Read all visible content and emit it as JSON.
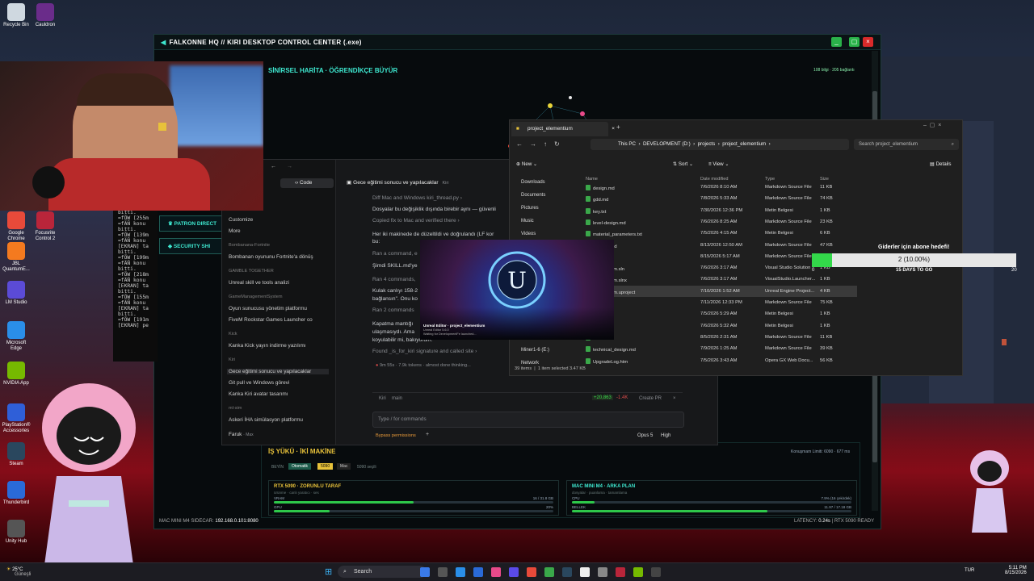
{
  "desktop": {
    "icons": [
      {
        "label": "Recycle Bin",
        "color": "#cfd8e0"
      },
      {
        "label": "Cauldron",
        "color": "#6a2c8a"
      },
      {
        "label": "Google Chrome",
        "color": "#e84a3a"
      },
      {
        "label": "Focusrite Control 2",
        "color": "#b9253a"
      },
      {
        "label": "JBL QuantumE...",
        "color": "#f47a1f"
      },
      {
        "label": "LM Studio",
        "color": "#5b4bd6"
      },
      {
        "label": "Microsoft Edge",
        "color": "#2a8ee8"
      },
      {
        "label": "NVIDIA App",
        "color": "#76b900"
      },
      {
        "label": "PlayStation® Accessories",
        "color": "#2f5fd8"
      },
      {
        "label": "Steam",
        "color": "#2a475e"
      },
      {
        "label": "Thunderbird",
        "color": "#2a6ad8"
      },
      {
        "label": "Unity Hub",
        "color": "#555"
      }
    ]
  },
  "app": {
    "title": "FALKONNE HQ // KIRI DESKTOP CONTROL CENTER (.exe)",
    "map_title": "SİNİRSEL HARİTA · ÖĞRENDİKÇE BÜYÜR",
    "map_stats": "108 bilgi · 205 bağlantı",
    "side_buttons": [
      "PATRON DIRECT",
      "SECURITY SHI"
    ],
    "status_left_label": "MAC MINI M4 SIDECAR:",
    "status_left_value": "192.168.0.101:8080",
    "status_right_label": "LATENCY:",
    "status_right_value": "0.24s",
    "status_right_extra": "| RTX 5090 READY",
    "workload": {
      "title": "İŞ YÜKÜ · İKİ MAKİNE",
      "usage": "Konuşmam Limiti: 6090 · 677 ms",
      "filter_label": "BEYİN",
      "filters": [
        "Otomatik",
        "5090",
        "Mac",
        "5090 seçili"
      ],
      "left": {
        "title": "RTX 5090 · ZORUNLU TARAF",
        "sub": "ürünme · canlı yaratıcı · ses",
        "vram_label": "VRAM",
        "vram_value": "16 / 31.8 GB",
        "vram_pct": 0.5,
        "gpu_label": "GPU",
        "gpu_value": "20%",
        "gpu_pct": 0.2
      },
      "right": {
        "title": "MAC MINI M4 · ARKA PLAN",
        "sub": "dosyalar · puanlama · tamamlama",
        "cpu_label": "CPU",
        "cpu_value": "7.9% (16 çekirdek)",
        "cpu_pct": 0.08,
        "mem_label": "BELLEK",
        "mem_value": "11.97 / 17.18 GB",
        "mem_pct": 0.7
      }
    }
  },
  "terminal": {
    "lines": [
      "bitti.",
      "=fÖW [255m",
      "=fÄÑ konu",
      "bitti.",
      "=fÖW [139m",
      "=fÄÑ konu",
      "[EKRAN] ta",
      "bitti.",
      "=fÖW [199m",
      "=fÄÑ konu",
      "bitti.",
      "=fÖW [218m",
      "=fÄÑ konu",
      "[EKRAN] ta",
      "bitti.",
      "=fÖW [155m",
      "=fÄÑ konu",
      "[EKRAN] ta",
      "bitti.",
      "=fÖW [191m",
      "[EKRAN] pe"
    ]
  },
  "code": {
    "tab": "Code",
    "thread_title": "Gece eğitimi sonucu ve yapılacaklar",
    "thread_badge": "Kiri",
    "side_items": [
      {
        "type": "item",
        "text": "Customize"
      },
      {
        "type": "item",
        "text": "More"
      },
      {
        "type": "group",
        "text": "Bombanana-Fortnite"
      },
      {
        "type": "item",
        "text": "Bombanan oyununu Fortnite'a dönüş"
      },
      {
        "type": "group",
        "text": "GAMBLE TOGETHER"
      },
      {
        "type": "item",
        "text": "Unreal skill ve tools analizi"
      },
      {
        "type": "group",
        "text": "GameManagementSystem"
      },
      {
        "type": "item",
        "text": "Oyun sunucusu yönetim platformu"
      },
      {
        "type": "item",
        "text": "FiveM Rockstar Games Launcher co"
      },
      {
        "type": "group",
        "text": "Kick"
      },
      {
        "type": "item",
        "text": "Kanka Kick yayın indirme yazılımı"
      },
      {
        "type": "group",
        "text": "Kiri"
      },
      {
        "type": "item",
        "text": "Gece eğitimi sonucu ve yapılacaklar"
      },
      {
        "type": "item",
        "text": "Git pull ve Windows görevi"
      },
      {
        "type": "item",
        "text": "Kanka Kiri avatar tasarımı"
      },
      {
        "type": "group",
        "text": "ml-sim"
      },
      {
        "type": "item",
        "text": "Askeri İHA simülasyon platformu"
      }
    ],
    "user": "Faruk",
    "user_plan": "Max",
    "lines": [
      {
        "text": "Diff Mac and Windows kiri_thread.py ›",
        "dim": true
      },
      {
        "text": "Dosyalar bu değişiklik dışında birebir aynı — güvenli",
        "dim": false
      },
      {
        "text": "Copied fix to Mac and verified there ›",
        "dim": true
      },
      {
        "text": "Her iki makinede de düzeltildi ve doğrulandı (LF kor",
        "dim": false
      },
      {
        "text": "bu:",
        "dim": false
      },
      {
        "text": "Ran a command, e",
        "dim": true
      },
      {
        "text": "Şimdi SKILL.md'ye",
        "dim": false
      },
      {
        "text": "Ran 4 commands,",
        "dim": true
      },
      {
        "text": "Kulak canlıyı 158-2",
        "dim": false
      },
      {
        "text": "bağlansın\". Onu ko",
        "dim": false
      },
      {
        "text": "Ran 2 commands",
        "dim": true
      },
      {
        "text": "Kapatma mantığı",
        "dim": false
      },
      {
        "text": "ulaşmasıydı. Ama",
        "dim": false
      },
      {
        "text": "koyulabilir mi, bakıyorum.",
        "dim": false
      },
      {
        "text": "Found _is_for_kiri signature and called site ›",
        "dim": true
      }
    ],
    "thinking": "9m 55s · 7.9k tokens · almost done thinking...",
    "branch_user": "Kiri",
    "branch": "main",
    "diff": "+20,863",
    "diff_minus": "-1.4K",
    "create_pr": "Create PR",
    "input_placeholder": "Type / for commands",
    "bypass": "Bypass permissions",
    "model": "Opus 5",
    "effort": "High"
  },
  "explorer": {
    "tab": "project_elementium",
    "breadcrumb": [
      "This PC",
      "DEVELOPMENT (D:)",
      "projects",
      "project_elementium"
    ],
    "search": "Search project_elementium",
    "toolbar": [
      "New",
      "Sort",
      "View",
      "Details"
    ],
    "columns": [
      "Name",
      "Date modified",
      "Type",
      "Size"
    ],
    "nav": [
      "Downloads",
      "Documents",
      "Pictures",
      "Music",
      "Videos",
      "Miner1-6 (E:)",
      "Network"
    ],
    "files": [
      [
        "design.md",
        "7/6/2026 8:10 AM",
        "Markdown Source File",
        "11 KB"
      ],
      [
        "gdd.md",
        "7/8/2026 5:33 AM",
        "Markdown Source File",
        "74 KB"
      ],
      [
        "key.txt",
        "7/30/2026 12:36 PM",
        "Metin Belgesi",
        "1 KB"
      ],
      [
        "level-design.md",
        "7/6/2026 8:25 AM",
        "Markdown Source File",
        "23 KB"
      ],
      [
        "material_parameters.txt",
        "7/5/2026 4:15 AM",
        "Metin Belgesi",
        "6 KB"
      ],
      [
        "pipeline.md",
        "8/13/2026 12:50 AM",
        "Markdown Source File",
        "47 KB"
      ],
      [
        ".md",
        "8/15/2026 5:17 AM",
        "Markdown Source File",
        "10 KB"
      ],
      [
        "elementium.sln",
        "7/6/2026 3:17 AM",
        "Visual Studio Solution",
        "1 KB"
      ],
      [
        "elementium.slnx",
        "7/6/2026 3:17 AM",
        "VisualStudio.Launcher...",
        "1 KB"
      ],
      [
        "elementium.uproject",
        "7/10/2026 1:52 AM",
        "Unreal Engine Project...",
        "4 KB"
      ],
      [
        ".md",
        "7/11/2026 12:33 PM",
        "Markdown Source File",
        "75 KB"
      ],
      [
        "search.txt",
        "7/5/2026 5:29 AM",
        "Metin Belgesi",
        "1 KB"
      ],
      [
        ".txt",
        "7/6/2026 5:32 AM",
        "Metin Belgesi",
        "1 KB"
      ],
      [
        ".md",
        "8/5/2026 2:31 AM",
        "Markdown Source File",
        "11 KB"
      ],
      [
        "technical_design.md",
        "7/9/2026 1:25 AM",
        "Markdown Source File",
        "39 KB"
      ],
      [
        "UpgradeLog.htm",
        "7/5/2026 3:43 AM",
        "Opera GX Web Docu...",
        "56 KB"
      ]
    ],
    "status_items": "39 items",
    "status_selected": "1 item selected  3.47 KB"
  },
  "splash": {
    "title": "Unreal Editor · project_elementium",
    "version": "Unreal Editor 5.6.0",
    "status": "Waiting for DevelopmentFe launched..."
  },
  "goal": {
    "title": "Giderler için abone hedefi!",
    "value_text": "2 (10.00%)",
    "fraction": 0.1,
    "min": "0",
    "max": "20",
    "days": "15 DAYS TO GO"
  },
  "taskbar": {
    "weather_temp": "25°C",
    "weather_desc": "Güneşli",
    "search": "Search",
    "lang": "TUR",
    "time": "5:11 PM",
    "date": "8/15/2026"
  }
}
